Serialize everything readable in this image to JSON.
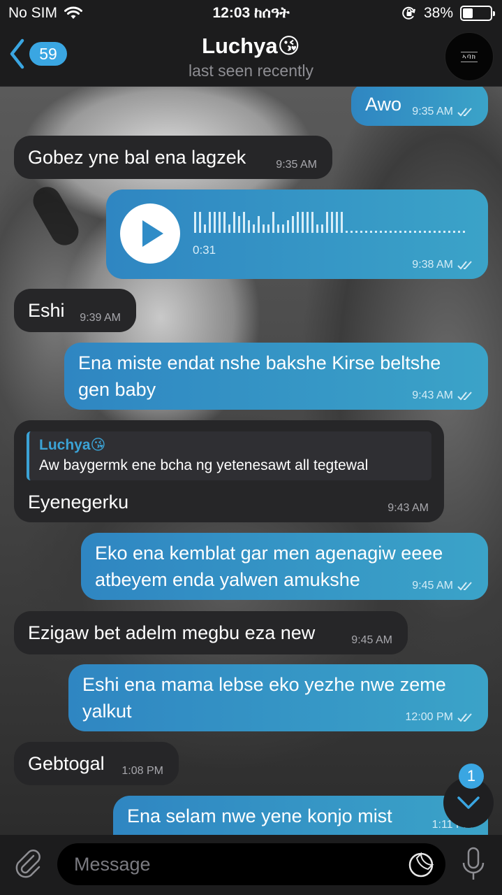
{
  "status_bar": {
    "carrier": "No SIM",
    "time": "12:03 ከሰዓት",
    "battery_text": "38%",
    "battery_level": 0.38
  },
  "header": {
    "back_count": "59",
    "title": "Luchya😘",
    "subtitle": "last seen recently"
  },
  "messages": [
    {
      "dir": "out",
      "text": "Awo",
      "time": "9:35 AM"
    },
    {
      "dir": "in",
      "text": "Gobez yne bal ena lagzek",
      "time": "9:35 AM"
    },
    {
      "dir": "out",
      "type": "voice",
      "duration": "0:31",
      "time": "9:38 AM"
    },
    {
      "dir": "in",
      "text": "Eshi",
      "time": "9:39 AM"
    },
    {
      "dir": "out",
      "text": "Ena miste endat nshe bakshe Kirse beltshe gen baby",
      "time": "9:43 AM"
    },
    {
      "dir": "in",
      "reply_name": "Luchya😘",
      "reply_text": "Aw baygermk ene bcha ng yetenesawt all tegtewal",
      "text": "Eyenegerku",
      "time": "9:43 AM"
    },
    {
      "dir": "out",
      "text": "Eko ena kemblat gar men agenagiw eeee atbeyem enda yalwen amukshe",
      "time": "9:45 AM"
    },
    {
      "dir": "in",
      "text": "Ezigaw bet adelm megbu eza new",
      "time": "9:45 AM"
    },
    {
      "dir": "out",
      "text": "Eshi ena mama lebse eko yezhe nwe zeme yalkut",
      "time": "12:00 PM"
    },
    {
      "dir": "in",
      "text": "Gebtogal",
      "time": "1:08 PM"
    },
    {
      "dir": "out",
      "text": "Ena selam nwe yene konjo mist",
      "time": "1:11 PM"
    }
  ],
  "unread_badge": "1",
  "input": {
    "placeholder": "Message"
  },
  "colors": {
    "accent": "#3aa6e2",
    "outgoing_start": "#2f86c2",
    "outgoing_end": "#3ba3c8",
    "incoming": "#262628"
  }
}
